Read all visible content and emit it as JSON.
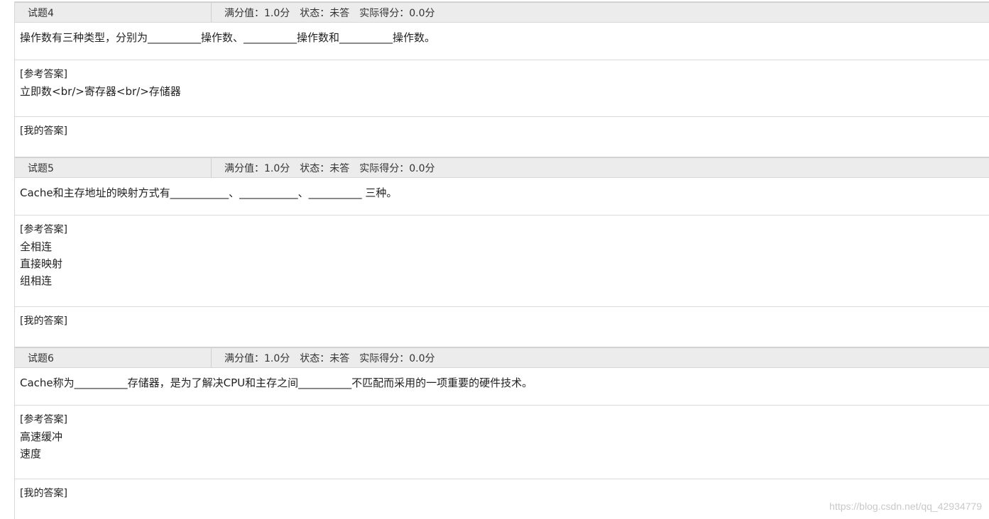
{
  "questions": [
    {
      "number": "试题4",
      "full_score": "满分值：1.0分",
      "status": "状态：未答",
      "actual_score": "实际得分：0.0分",
      "stem": "操作数有三种类型，分别为__________操作数、__________操作数和__________操作数。",
      "ref_label": "[参考答案]",
      "answers": [
        "立即数<br/>寄存器<br/>存储器"
      ],
      "mine_label": "[我的答案]"
    },
    {
      "number": "试题5",
      "full_score": "满分值：1.0分",
      "status": "状态：未答",
      "actual_score": "实际得分：0.0分",
      "stem": "Cache和主存地址的映射方式有___________、___________、__________ 三种。",
      "ref_label": "[参考答案]",
      "answers": [
        "全相连",
        "直接映射",
        "组相连"
      ],
      "mine_label": "[我的答案]"
    },
    {
      "number": "试题6",
      "full_score": "满分值：1.0分",
      "status": "状态：未答",
      "actual_score": "实际得分：0.0分",
      "stem": "Cache称为__________存储器，是为了解决CPU和主存之间__________不匹配而采用的一项重要的硬件技术。",
      "ref_label": "[参考答案]",
      "answers": [
        "高速缓冲",
        "速度"
      ],
      "mine_label": "[我的答案]"
    }
  ],
  "watermark": "https://blog.csdn.net/qq_42934779"
}
